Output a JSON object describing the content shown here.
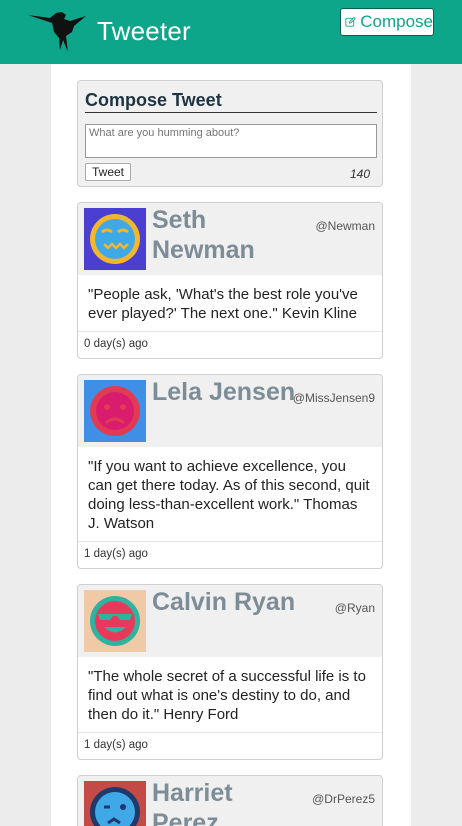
{
  "header": {
    "title": "Tweeter",
    "compose_label": "Compose",
    "accent": "#0ea68a"
  },
  "compose": {
    "heading": "Compose Tweet",
    "placeholder": "What are you humming about?",
    "button_label": "Tweet",
    "counter": "140"
  },
  "tweets": [
    {
      "name": "Seth Newman",
      "handle": "@Newman",
      "text": "\"People ask, 'What's the best role you've ever played?' The next one.\" Kevin Kline",
      "age": "0 day(s) ago",
      "avatar_icon": "sad-face-icon"
    },
    {
      "name": "Lela Jensen",
      "handle": "@MissJensen9",
      "text": "\"If you want to achieve excellence, you can get there today. As of this second, quit doing less-than-excellent work.\" Thomas J. Watson",
      "age": "1 day(s) ago",
      "avatar_icon": "angry-face-icon"
    },
    {
      "name": "Calvin Ryan",
      "handle": "@Ryan",
      "text": "\"The whole secret of a successful life is to find out what is one's destiny to do, and then do it.\" Henry Ford",
      "age": "1 day(s) ago",
      "avatar_icon": "sunglasses-face-icon"
    },
    {
      "name": "Harriet Perez",
      "handle": "@DrPerez5",
      "text": "",
      "age": "",
      "avatar_icon": "winking-face-icon"
    }
  ]
}
